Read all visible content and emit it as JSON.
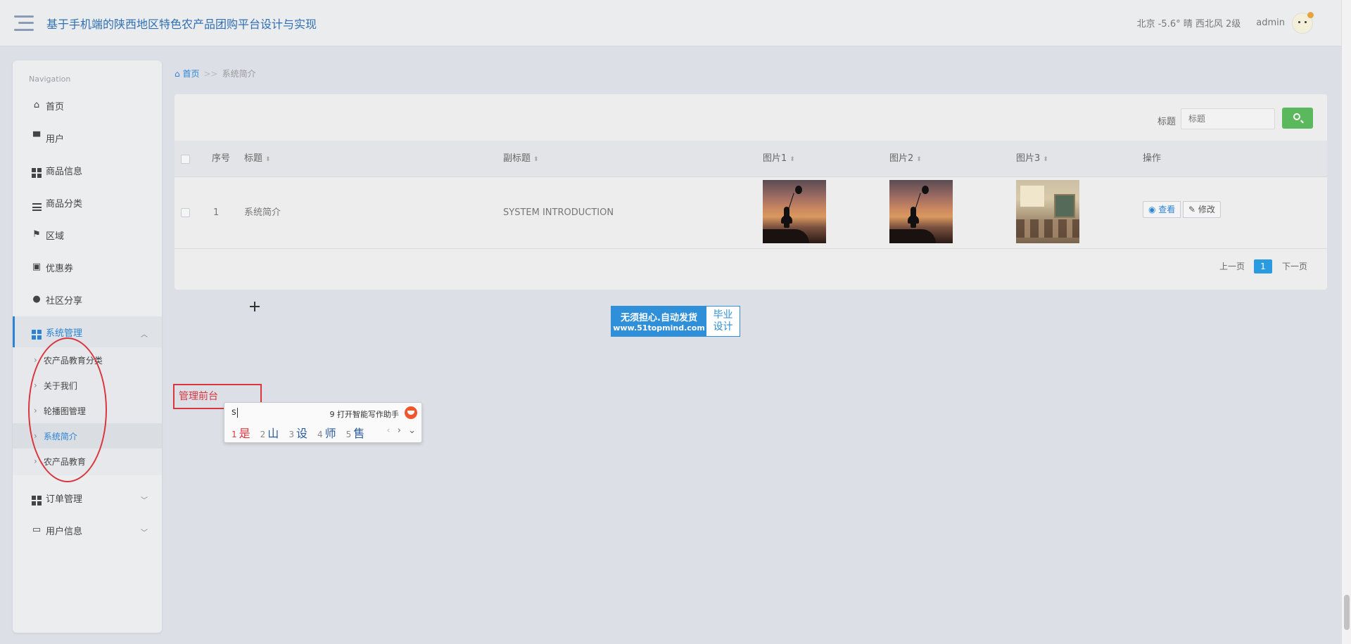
{
  "header": {
    "title": "基于手机端的陕西地区特色农产品团购平台设计与实现",
    "weather": "北京  -5.6°  晴  西北风  2级",
    "user": "admin"
  },
  "sidebar": {
    "caption": "Navigation",
    "items": [
      {
        "label": "首页"
      },
      {
        "label": "用户"
      },
      {
        "label": "商品信息"
      },
      {
        "label": "商品分类"
      },
      {
        "label": "区域"
      },
      {
        "label": "优惠券"
      },
      {
        "label": "社区分享"
      },
      {
        "label": "系统管理"
      },
      {
        "label": "订单管理"
      },
      {
        "label": "用户信息"
      }
    ],
    "sub_items": [
      {
        "label": "农产品教育分类"
      },
      {
        "label": "关于我们"
      },
      {
        "label": "轮播图管理"
      },
      {
        "label": "系统简介"
      },
      {
        "label": "农产品教育"
      }
    ]
  },
  "breadcrumb": {
    "home": "首页",
    "sep": ">>",
    "current": "系统简介"
  },
  "search": {
    "label": "标题",
    "placeholder": "标题"
  },
  "table": {
    "columns": [
      "序号",
      "标题",
      "副标题",
      "图片1",
      "图片2",
      "图片3",
      "操作"
    ],
    "sort_glyph": "⬍",
    "rows": [
      {
        "index": "1",
        "title": "系统简介",
        "subtitle": "SYSTEM INTRODUCTION",
        "view": "查看",
        "edit": "修改"
      }
    ]
  },
  "pagination": {
    "prev": "上一页",
    "current": "1",
    "next": "下一页"
  },
  "watermark": {
    "line1": "无须担心.自动发货",
    "line2": "www.51topmind.com",
    "right1": "毕业",
    "right2": "设计"
  },
  "admin_front": "管理前台",
  "ime": {
    "input": "s",
    "assist_key": "9",
    "assist": "打开智能写作助手",
    "candidates": [
      {
        "n": "1",
        "c": "是"
      },
      {
        "n": "2",
        "c": "山"
      },
      {
        "n": "3",
        "c": "设"
      },
      {
        "n": "4",
        "c": "师"
      },
      {
        "n": "5",
        "c": "售"
      }
    ],
    "prev_glyph": "‹",
    "next_glyph": "›",
    "more_glyph": "⌄"
  },
  "colors": {
    "accent": "#2a84d6",
    "search_button": "#5cb85c",
    "annotation": "#d9363e"
  }
}
